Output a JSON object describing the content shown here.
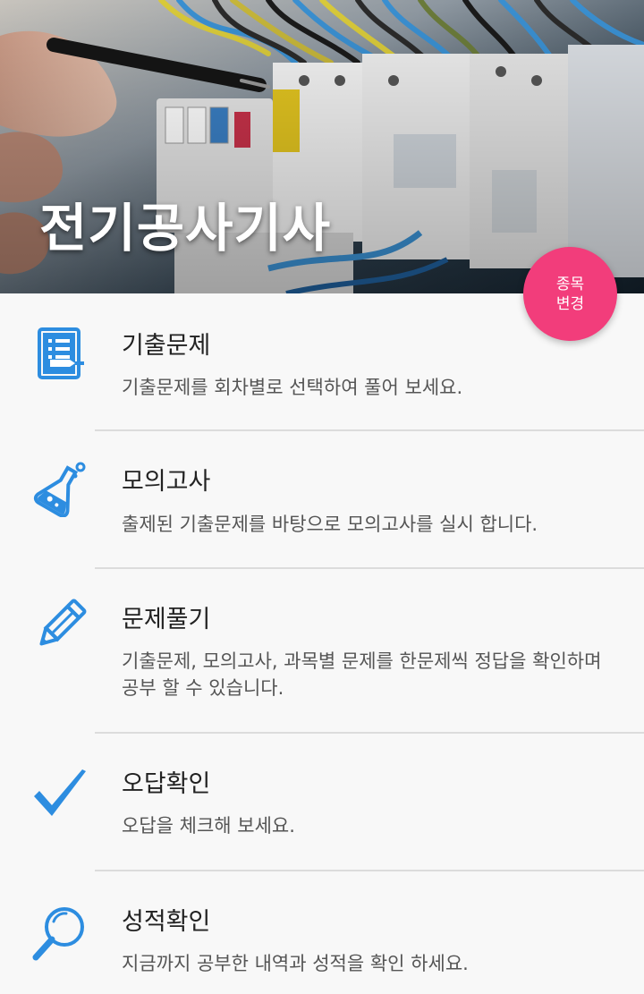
{
  "header": {
    "title": "전기공사기사",
    "change_button": {
      "line1": "종목",
      "line2": "변경"
    }
  },
  "menu": {
    "items": [
      {
        "title": "기출문제",
        "description": "기출문제를 회차별로 선택하여 풀어 보세요.",
        "icon": "notebook-icon"
      },
      {
        "title": "모의고사",
        "description": "출제된 기출문제를 바탕으로 모의고사를 실시 합니다.",
        "icon": "flask-icon"
      },
      {
        "title": "문제풀기",
        "description": "기출문제, 모의고사, 과목별 문제를 한문제씩 정답을 확인하며 공부 할 수 있습니다.",
        "icon": "pencil-icon"
      },
      {
        "title": "오답확인",
        "description": "오답을 체크해 보세요.",
        "icon": "checkmark-icon"
      },
      {
        "title": "성적확인",
        "description": "지금까지 공부한 내역과 성적을 확인 하세요.",
        "icon": "magnifier-icon"
      }
    ]
  },
  "colors": {
    "accent": "#f23d7b",
    "icon_blue": "#2d8de0",
    "title_text": "#222222",
    "desc_text": "#555555"
  }
}
